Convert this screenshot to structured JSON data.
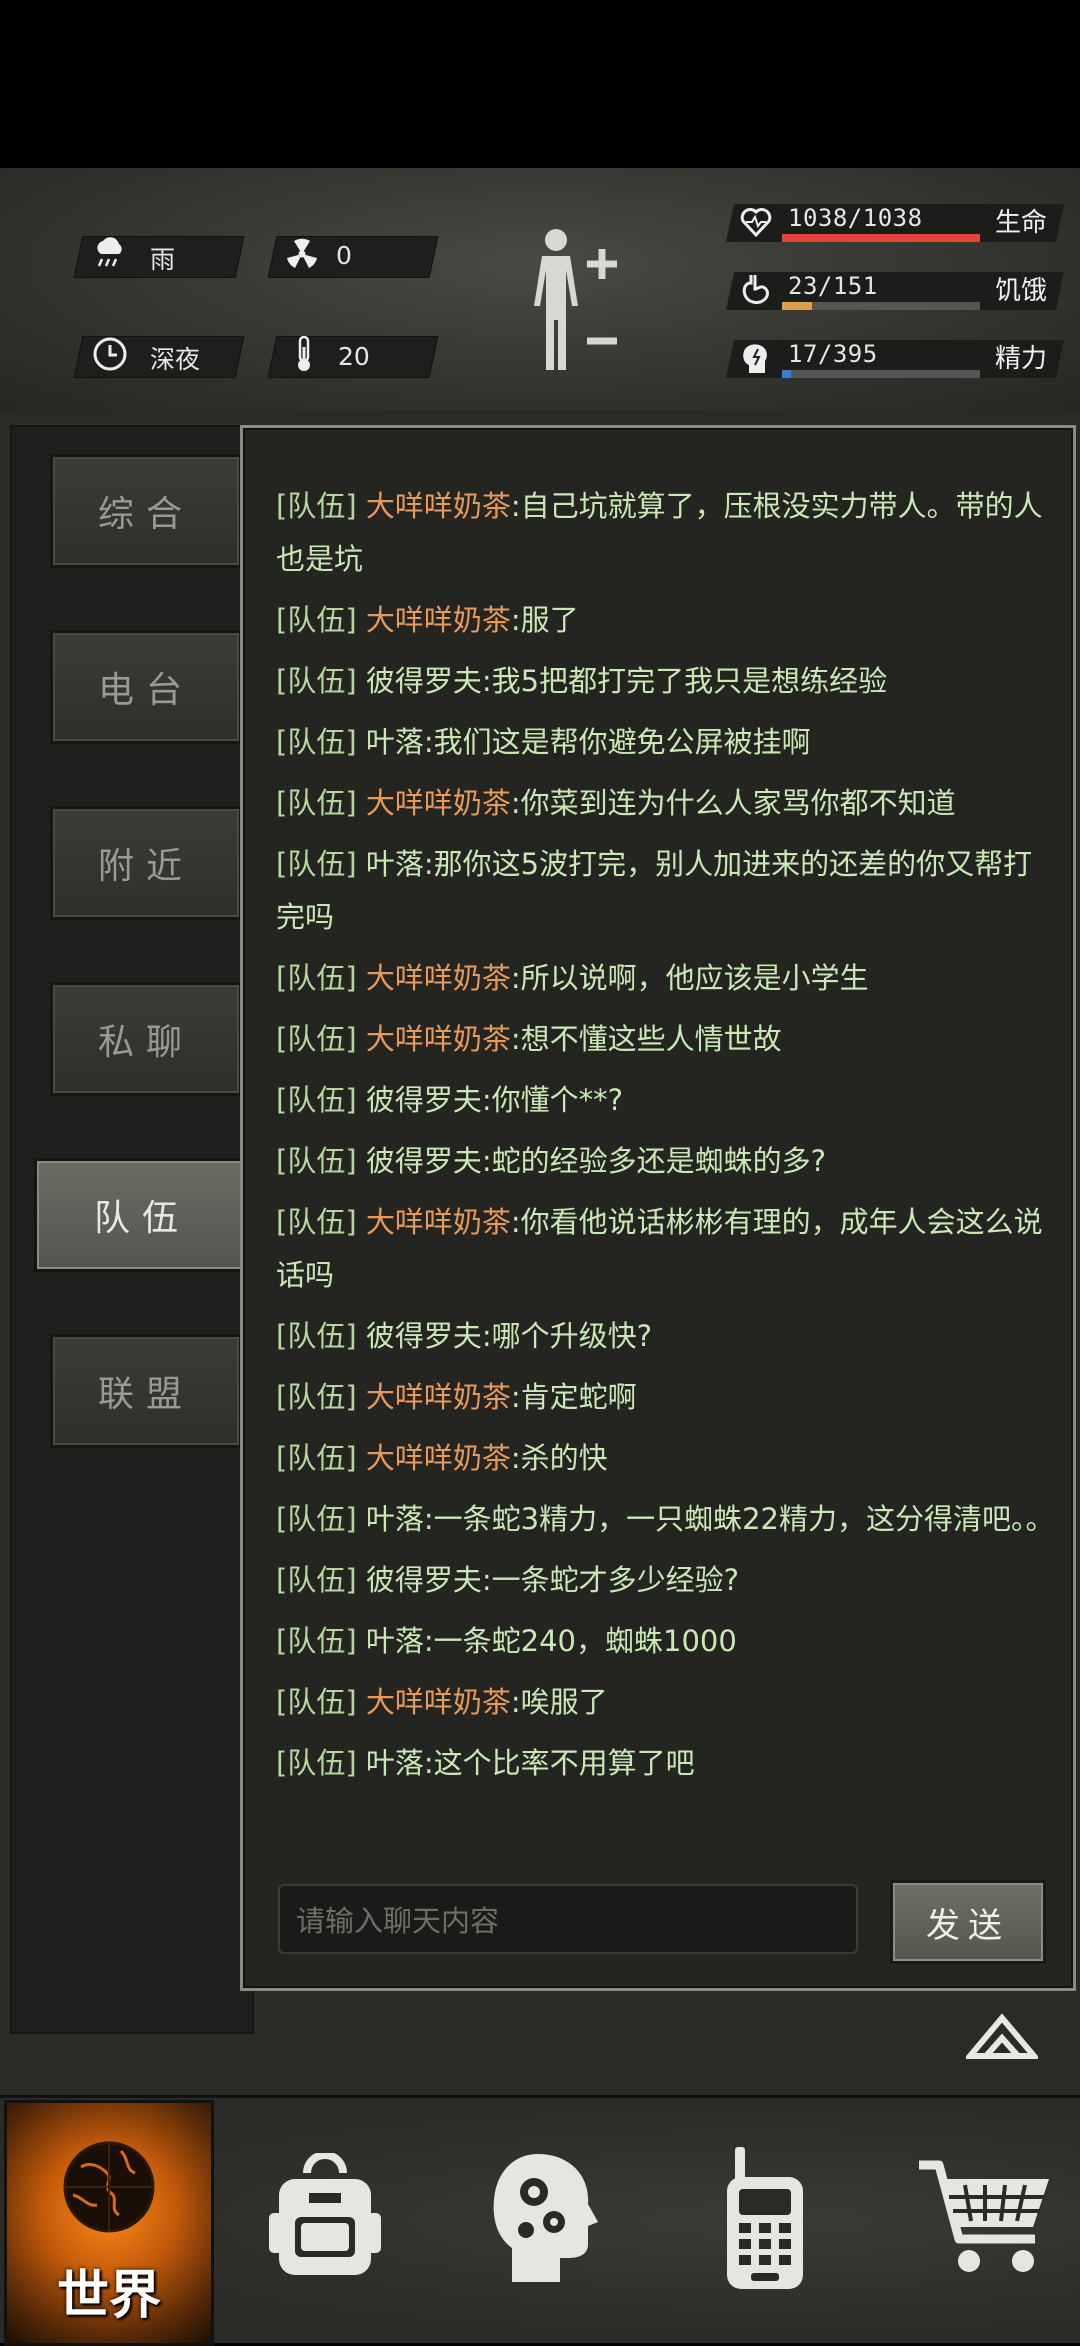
{
  "status": {
    "weather": {
      "icon": "rain-cloud-icon",
      "label": "雨"
    },
    "radiation": {
      "icon": "radiation-icon",
      "value": "0"
    },
    "time": {
      "icon": "clock-icon",
      "label": "深夜"
    },
    "temperature": {
      "icon": "thermometer-icon",
      "value": "20"
    },
    "stats": [
      {
        "icon": "heart-icon",
        "value": "1038/1038",
        "label": "生命",
        "fraction": 1.0,
        "color": "#e0473a"
      },
      {
        "icon": "stomach-icon",
        "value": "23/151",
        "label": "饥饿",
        "fraction": 0.152,
        "color": "#d9a24a"
      },
      {
        "icon": "brain-icon",
        "value": "17/395",
        "label": "精力",
        "fraction": 0.043,
        "color": "#3a7ad9"
      }
    ]
  },
  "sidebar": {
    "tabs": [
      {
        "label": "综合",
        "active": false
      },
      {
        "label": "电台",
        "active": false
      },
      {
        "label": "附近",
        "active": false
      },
      {
        "label": "私聊",
        "active": false
      },
      {
        "label": "队伍",
        "active": true
      },
      {
        "label": "联盟",
        "active": false
      }
    ]
  },
  "chat": {
    "messages": [
      {
        "channel": "[队伍]",
        "sender": "大咩咩奶茶",
        "sender_color": "orange",
        "text": ":自己坑就算了，压根没实力带人。带的人也是坑"
      },
      {
        "channel": "[队伍]",
        "sender": "大咩咩奶茶",
        "sender_color": "orange",
        "text": ":服了"
      },
      {
        "channel": "[队伍]",
        "sender": "彼得罗夫",
        "sender_color": "green",
        "text": ":我5把都打完了我只是想练经验"
      },
      {
        "channel": "[队伍]",
        "sender": "叶落",
        "sender_color": "green",
        "text": ":我们这是帮你避免公屏被挂啊"
      },
      {
        "channel": "[队伍]",
        "sender": "大咩咩奶茶",
        "sender_color": "orange",
        "text": ":你菜到连为什么人家骂你都不知道"
      },
      {
        "channel": "[队伍]",
        "sender": "叶落",
        "sender_color": "green",
        "text": ":那你这5波打完，别人加进来的还差的你又帮打完吗"
      },
      {
        "channel": "[队伍]",
        "sender": "大咩咩奶茶",
        "sender_color": "orange",
        "text": ":所以说啊，他应该是小学生"
      },
      {
        "channel": "[队伍]",
        "sender": "大咩咩奶茶",
        "sender_color": "orange",
        "text": ":想不懂这些人情世故"
      },
      {
        "channel": "[队伍]",
        "sender": "彼得罗夫",
        "sender_color": "green",
        "text": ":你懂个**?"
      },
      {
        "channel": "[队伍]",
        "sender": "彼得罗夫",
        "sender_color": "green",
        "text": ":蛇的经验多还是蜘蛛的多?"
      },
      {
        "channel": "[队伍]",
        "sender": "大咩咩奶茶",
        "sender_color": "orange",
        "text": ":你看他说话彬彬有理的，成年人会这么说话吗"
      },
      {
        "channel": "[队伍]",
        "sender": "彼得罗夫",
        "sender_color": "green",
        "text": ":哪个升级快?"
      },
      {
        "channel": "[队伍]",
        "sender": "大咩咩奶茶",
        "sender_color": "orange",
        "text": ":肯定蛇啊"
      },
      {
        "channel": "[队伍]",
        "sender": "大咩咩奶茶",
        "sender_color": "orange",
        "text": ":杀的快"
      },
      {
        "channel": "[队伍]",
        "sender": "叶落",
        "sender_color": "green",
        "text": ":一条蛇3精力，一只蜘蛛22精力，这分得清吧。。"
      },
      {
        "channel": "[队伍]",
        "sender": "彼得罗夫",
        "sender_color": "green",
        "text": ":一条蛇才多少经验?"
      },
      {
        "channel": "[队伍]",
        "sender": "叶落",
        "sender_color": "green",
        "text": ":一条蛇240，蜘蛛1000"
      },
      {
        "channel": "[队伍]",
        "sender": "大咩咩奶茶",
        "sender_color": "orange",
        "text": ":唉服了"
      },
      {
        "channel": "[队伍]",
        "sender": "叶落",
        "sender_color": "green",
        "text": ":这个比率不用算了吧"
      }
    ],
    "input_placeholder": "请输入聊天内容",
    "send_label": "发送"
  },
  "bottom_nav": {
    "items": [
      {
        "icon": "globe-icon",
        "label": "世界",
        "active": true
      },
      {
        "icon": "backpack-icon",
        "label": "",
        "active": false
      },
      {
        "icon": "head-gears-icon",
        "label": "",
        "active": false
      },
      {
        "icon": "walkie-talkie-icon",
        "label": "",
        "active": false
      },
      {
        "icon": "shopping-cart-icon",
        "label": "",
        "active": false
      }
    ]
  }
}
